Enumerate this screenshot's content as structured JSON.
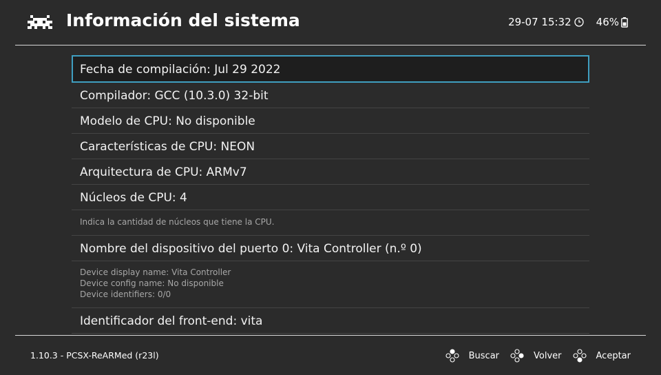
{
  "header": {
    "title": "Información del sistema",
    "datetime": "29-07 15:32",
    "battery": "46%",
    "logo_icon": "retroarch-invader-icon",
    "clock_icon": "clock-icon",
    "battery_icon": "battery-icon"
  },
  "list": {
    "items": [
      {
        "label": "Fecha de compilación: Jul 29 2022"
      },
      {
        "label": "Compilador: GCC (10.3.0) 32-bit"
      },
      {
        "label": "Modelo de CPU: No disponible"
      },
      {
        "label": "Características de CPU:  NEON"
      },
      {
        "label": "Arquitectura de CPU: ARMv7"
      },
      {
        "label": "Núcleos de CPU: 4"
      },
      {
        "label": "Nombre del dispositivo del puerto 0: Vita Controller (n.º 0)"
      },
      {
        "label": "Identificador del front-end: vita"
      }
    ],
    "cores_help": "Indica la cantidad de núcleos que tiene la CPU.",
    "device_info": [
      "Device display name: Vita Controller",
      "Device config name: No disponible",
      "Device identifiers: 0/0"
    ]
  },
  "footer": {
    "version": "1.10.3 - PCSX-ReARMed (r23l)",
    "buttons": {
      "search": "Buscar",
      "back": "Volver",
      "accept": "Aceptar"
    }
  },
  "colors": {
    "background": "#2b2b2b",
    "selection_border": "#3f9fc1",
    "divider": "#d8d8d8"
  }
}
